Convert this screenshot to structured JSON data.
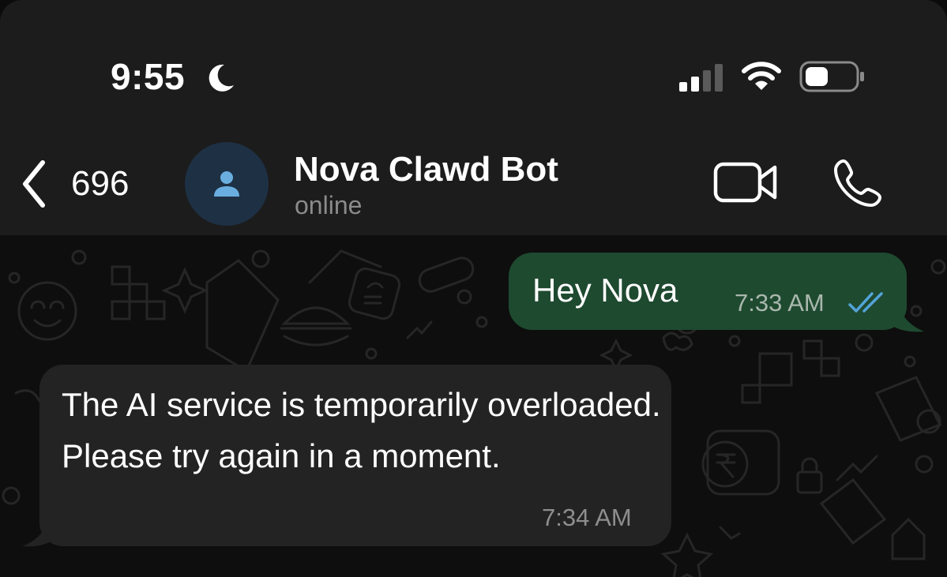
{
  "status_bar": {
    "time": "9:55",
    "icons": [
      "moon-icon",
      "signal-icon",
      "wifi-icon",
      "battery-icon"
    ]
  },
  "header": {
    "back_count": "696",
    "contact_name": "Nova Clawd Bot",
    "contact_status": "online",
    "actions": [
      "video-call-icon",
      "phone-icon"
    ]
  },
  "messages": [
    {
      "direction": "outgoing",
      "text": "Hey Nova",
      "time": "7:33 AM",
      "status": "read"
    },
    {
      "direction": "incoming",
      "text": "The AI service is temporarily overloaded. Please try again in a moment.",
      "time": "7:34 AM"
    }
  ],
  "colors": {
    "header_bg": "#1c1c1c",
    "chat_bg": "#0e0e0e",
    "outgoing_bubble": "#1e4a30",
    "incoming_bubble": "#232323",
    "read_check": "#53a3d9",
    "avatar_bg": "#1e3044",
    "avatar_fg": "#6aaee0"
  }
}
